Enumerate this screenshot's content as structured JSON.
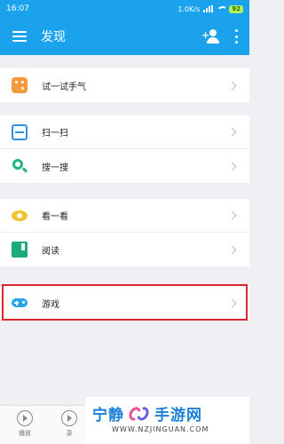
{
  "status_bar": {
    "time": "16:07",
    "speed": "1.0K/s",
    "battery": "92"
  },
  "app_bar": {
    "title": "发现"
  },
  "groups": [
    {
      "items": [
        {
          "label": "试一试手气",
          "icon": "dice-icon"
        }
      ]
    },
    {
      "items": [
        {
          "label": "扫一扫",
          "icon": "scan-icon"
        },
        {
          "label": "搜一搜",
          "icon": "search-icon"
        }
      ]
    },
    {
      "items": [
        {
          "label": "看一看",
          "icon": "eye-icon"
        },
        {
          "label": "阅读",
          "icon": "book-icon"
        }
      ]
    },
    {
      "items": [
        {
          "label": "游戏",
          "icon": "gamepad-icon"
        }
      ]
    }
  ],
  "tab_bar": {
    "tabs": [
      {
        "label": "播放"
      },
      {
        "label": "录"
      }
    ]
  },
  "watermark": {
    "title_left": "宁静",
    "title_right": "手游网",
    "url": "WWW.NZJINGUAN.COM"
  },
  "colors": {
    "primary": "#1aa3ec",
    "highlight": "#d9252d"
  }
}
